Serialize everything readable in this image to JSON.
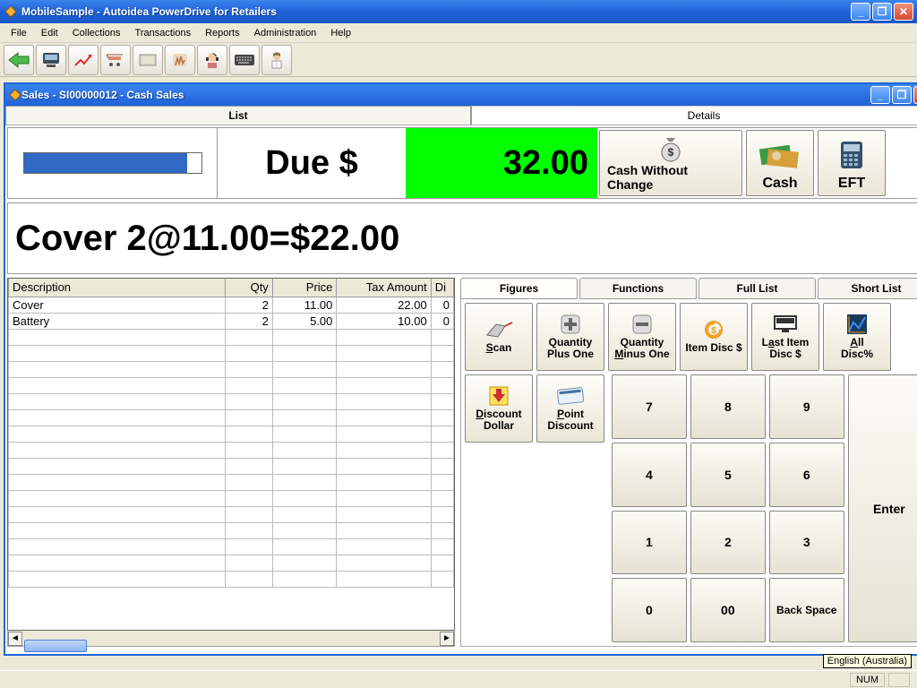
{
  "app": {
    "title": "MobileSample - Autoidea PowerDrive for Retailers"
  },
  "menu": {
    "file": "File",
    "edit": "Edit",
    "collections": "Collections",
    "transactions": "Transactions",
    "reports": "Reports",
    "administration": "Administration",
    "help": "Help"
  },
  "child": {
    "title": "Sales - SI00000012 - Cash Sales",
    "tabs": {
      "list": "List",
      "details": "Details"
    }
  },
  "summary": {
    "due_label": "Due $",
    "due_amount": "32.00"
  },
  "payment": {
    "cash_without_change": "Cash Without Change",
    "cash": "Cash",
    "eft": "EFT"
  },
  "line_display": "Cover 2@11.00=$22.00",
  "grid": {
    "headers": {
      "desc": "Description",
      "qty": "Qty",
      "price": "Price",
      "taxamt": "Tax Amount",
      "disc": "Di"
    },
    "rows": [
      {
        "desc": "Cover",
        "qty": "2",
        "price": "11.00",
        "taxamt": "22.00",
        "disc": "0"
      },
      {
        "desc": "Battery",
        "qty": "2",
        "price": "5.00",
        "taxamt": "10.00",
        "disc": "0"
      }
    ]
  },
  "keypad": {
    "tabs": {
      "figures": "Figures",
      "functions": "Functions",
      "full_list": "Full List",
      "short_list": "Short List"
    },
    "fn": {
      "scan_u": "S",
      "scan_rest": "can",
      "qty_plus": "Quantity\nPlus One",
      "qty_minus_u": "M",
      "qty_minus_pre": "Quantity\n",
      "qty_minus_rest": "inus One",
      "item_disc": "Item Disc $",
      "last_item_pre": "L",
      "last_item_u": "a",
      "last_item_post": "st Item\nDisc $",
      "all_disc_u": "A",
      "all_disc_rest": "ll\nDisc%",
      "disc_dollar_u": "D",
      "disc_dollar_rest": "iscount\nDollar",
      "point_disc_u": "P",
      "point_disc_rest": "oint\nDiscount"
    },
    "nums": {
      "n7": "7",
      "n8": "8",
      "n9": "9",
      "n4": "4",
      "n5": "5",
      "n6": "6",
      "n1": "1",
      "n2": "2",
      "n3": "3",
      "n0": "0",
      "n00": "00",
      "backspace": "Back Space",
      "enter": "Enter"
    }
  },
  "status": {
    "num": "NUM",
    "tooltip": "English (Australia)"
  }
}
